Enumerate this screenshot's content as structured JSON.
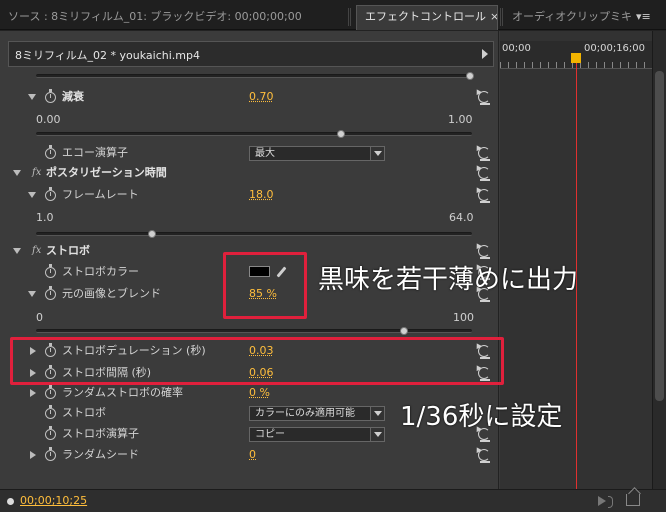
{
  "tabs": [
    {
      "label": "ソース : 8ミリフィルム_01: ブラックビデオ: 00;00;00;00"
    },
    {
      "label": "エフェクトコントロール",
      "close": "×"
    },
    {
      "label": "オーディオクリップミキ",
      "menu": "▾≡"
    }
  ],
  "clip": {
    "name": "8ミリフィルム_02 * youkaichi.mp4"
  },
  "timeline": {
    "t_start": "00;00",
    "t_marker": "00;00;16;00",
    "current": "00;00;10;25"
  },
  "props": {
    "decay": {
      "label": "減衰",
      "value": "0.70",
      "min": "0.00",
      "max": "1.00",
      "fraction": 0.7
    },
    "echo_op": {
      "label": "エコー演算子",
      "value": "最大"
    },
    "posterize": {
      "label": "ポスタリゼーション時間",
      "fx": "fx"
    },
    "framerate": {
      "label": "フレームレート",
      "value": "18.0",
      "min": "1.0",
      "max": "64.0",
      "fraction": 0.27
    },
    "strobe": {
      "label": "ストロボ",
      "fx": "fx"
    },
    "strobe_color": {
      "label": "ストロボカラー",
      "color": "#000000"
    },
    "blend": {
      "label": "元の画像とブレンド",
      "value": "85 %",
      "min": "0",
      "max": "100",
      "fraction": 0.85
    },
    "strobe_duration": {
      "label": "ストロボデュレーション (秒)",
      "value": "0.03"
    },
    "strobe_interval": {
      "label": "ストロボ間隔 (秒)",
      "value": "0.06"
    },
    "random_prob": {
      "label": "ランダムストロボの確率",
      "value": "0 %"
    },
    "strobe_mode": {
      "label": "ストロボ",
      "value": "カラーにのみ適用可能"
    },
    "strobe_op": {
      "label": "ストロボ演算子",
      "value": "コピー"
    },
    "random_seed": {
      "label": "ランダムシード",
      "value": "0"
    }
  },
  "annotations": {
    "note1": "黒味を若干薄めに出力",
    "note2": "1/36秒に設定",
    "color": "#e0203c"
  },
  "colors": {
    "value": "#ffbe3c",
    "playhead": "#e03030",
    "bg": "#3b3b3b"
  }
}
